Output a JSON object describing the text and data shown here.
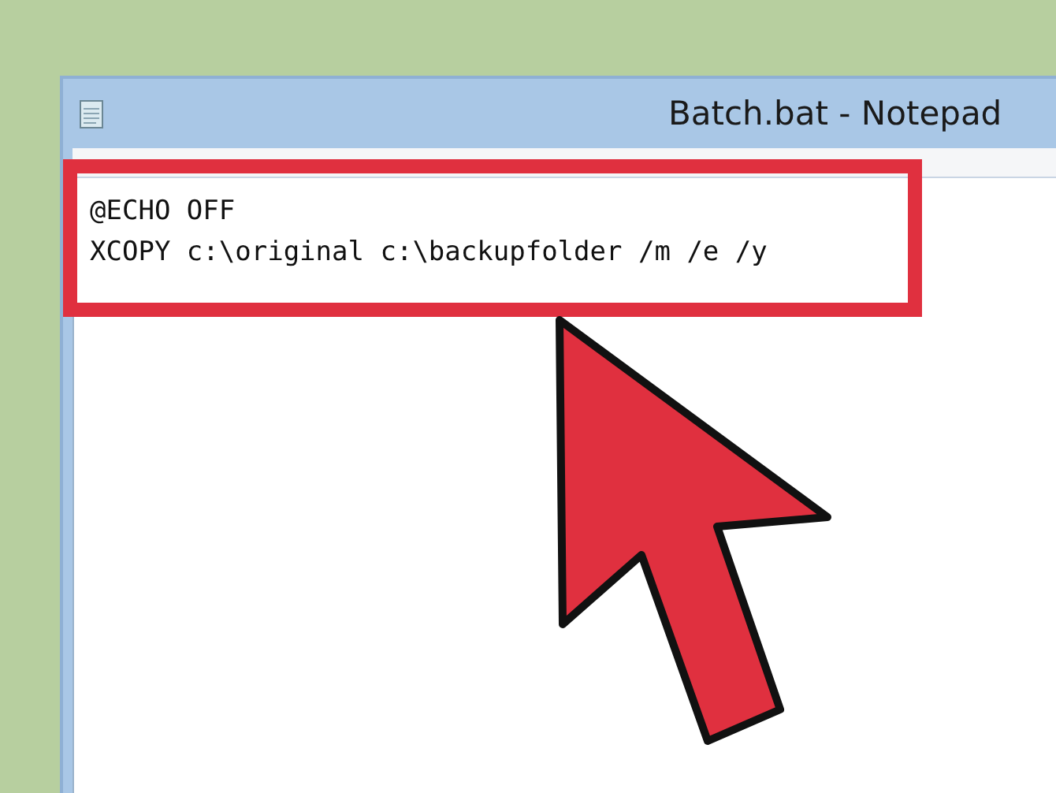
{
  "window": {
    "title": "Batch.bat - Notepad"
  },
  "editor": {
    "lines": [
      "@ECHO OFF",
      "XCOPY c:\\original c:\\backupfolder /m /e /y"
    ]
  }
}
